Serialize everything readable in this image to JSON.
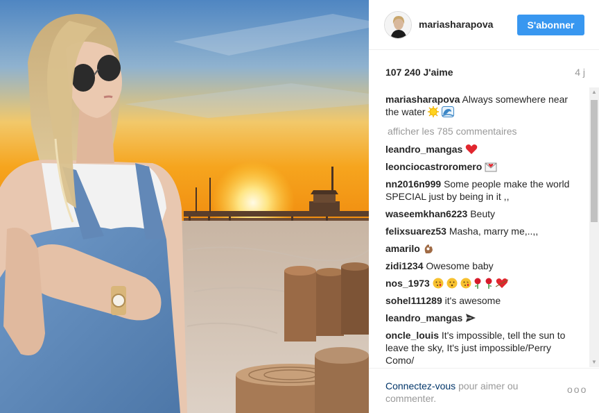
{
  "post": {
    "username": "mariasharapova",
    "follow_label": "S'abonner",
    "likes": "107 240 J'aime",
    "age": "4 j",
    "caption": {
      "user": "mariasharapova",
      "text": "Always somewhere near the water"
    },
    "view_all_label": "afficher les 785 commentaires"
  },
  "comments": [
    {
      "user": "leandro_mangas",
      "text": "",
      "icons": [
        "heart-icon"
      ]
    },
    {
      "user": "leonciocastroromero",
      "text": "",
      "icons": [
        "love-letter-icon"
      ]
    },
    {
      "user": "nn2016n999",
      "text": "Some people make the world SPECIAL just by being in it ,,",
      "icons": []
    },
    {
      "user": "waseemkhan6223",
      "text": "Beuty",
      "icons": []
    },
    {
      "user": "felixsuarez53",
      "text": "Masha, marry me,..,,",
      "icons": []
    },
    {
      "user": "amarilo",
      "text": "",
      "icons": [
        "ok-hand-icon"
      ]
    },
    {
      "user": "zidi1234",
      "text": "Owesome baby",
      "icons": []
    },
    {
      "user": "nos_1973",
      "text": "",
      "icons": [
        "kiss-face-icon",
        "kiss-face-icon",
        "kiss-face-icon",
        "rose-icon",
        "rose-icon",
        "heart-arrow-icon"
      ]
    },
    {
      "user": "sohel111289",
      "text": "it's awesome",
      "icons": []
    },
    {
      "user": "leandro_mangas",
      "text": "",
      "icons": [
        "airplane-icon"
      ]
    },
    {
      "user": "oncle_louis",
      "text": "It's impossible, tell the sun to leave the sky, It's just impossible/Perry Como/",
      "icons": []
    }
  ],
  "footer": {
    "login_link": "Connectez-vous",
    "login_rest": "pour aimer ou commenter.",
    "more_label": "ooo"
  },
  "colors": {
    "accent": "#3897f0",
    "link": "#003569",
    "muted": "#999999",
    "text": "#262626"
  }
}
